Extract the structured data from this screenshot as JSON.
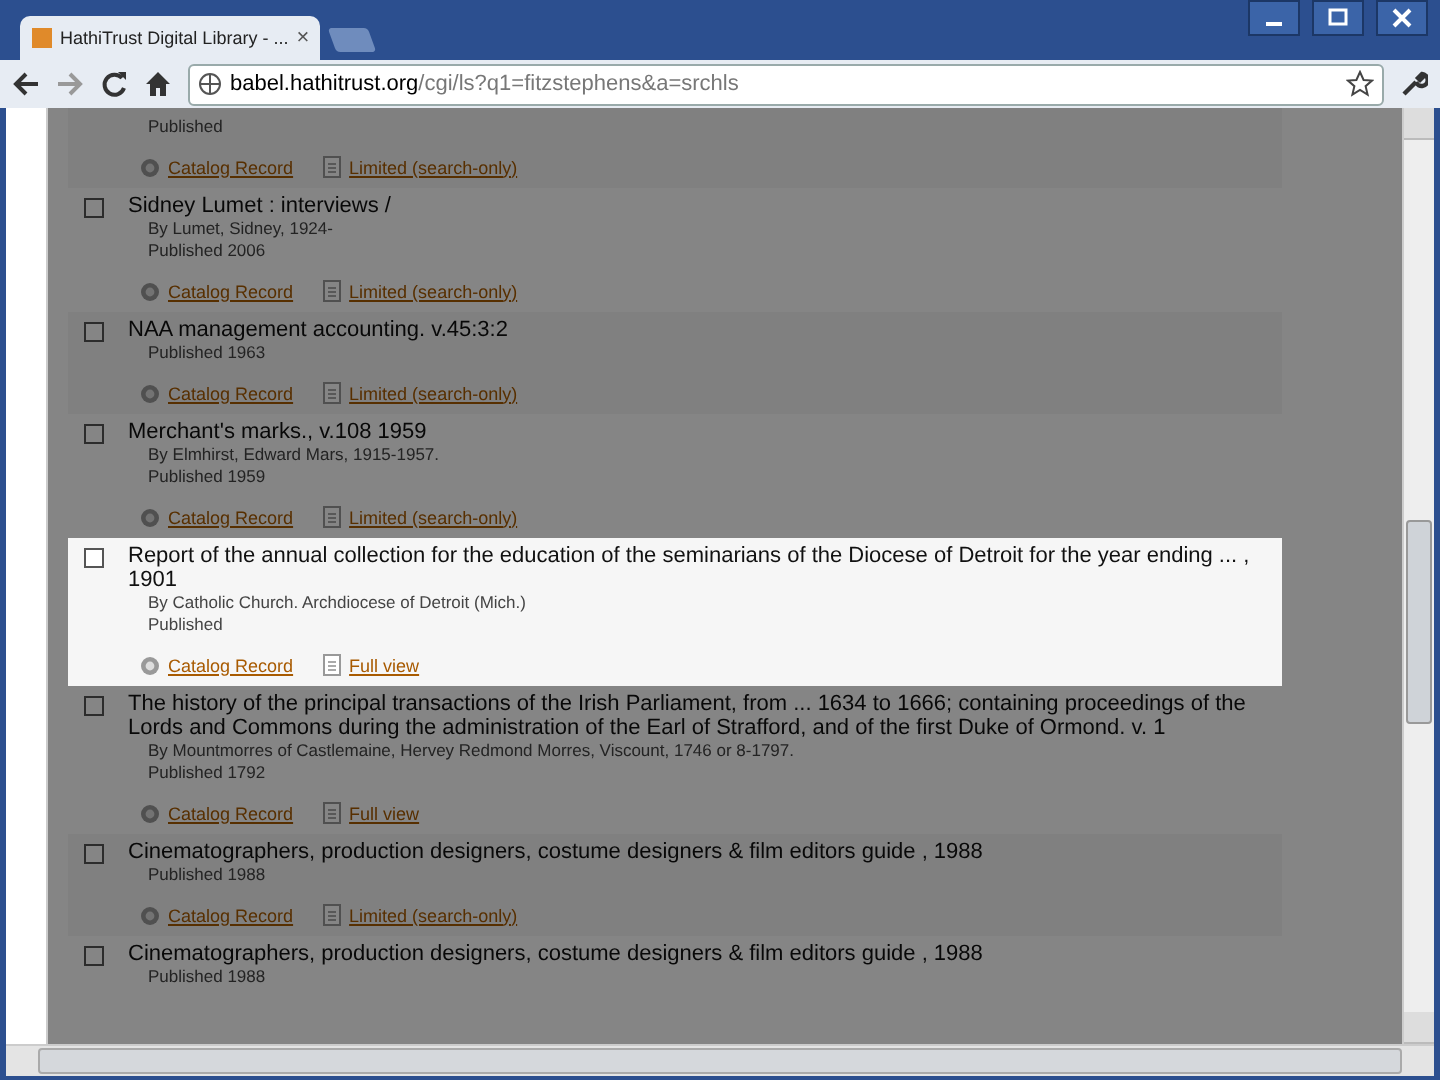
{
  "window": {
    "tab_title": "HathiTrust Digital Library - ...",
    "tab_close": "×"
  },
  "address_bar": {
    "domain": "babel.hathitrust.org",
    "path": "/cgi/ls?q1=fitzstephens&a=srchls"
  },
  "results": [
    {
      "published": "Published",
      "highlighted": false,
      "catalog_link": "Catalog Record",
      "access_link": "Limited (search-only)"
    },
    {
      "title": "Sidney Lumet : interviews /",
      "byline": "By Lumet, Sidney, 1924-",
      "published": "Published 2006",
      "highlighted": false,
      "catalog_link": "Catalog Record",
      "access_link": "Limited (search-only)"
    },
    {
      "title": "NAA management accounting. v.45:3:2",
      "published": "Published 1963",
      "highlighted": false,
      "catalog_link": "Catalog Record",
      "access_link": "Limited (search-only)"
    },
    {
      "title": "Merchant's marks., v.108 1959",
      "byline": "By Elmhirst, Edward Mars, 1915-1957.",
      "published": "Published 1959",
      "highlighted": false,
      "catalog_link": "Catalog Record",
      "access_link": "Limited (search-only)"
    },
    {
      "title": "Report of the annual collection for the education of the seminarians of the Diocese of Detroit for the year ending ... , 1901",
      "byline": "By Catholic Church. Archdiocese of Detroit (Mich.)",
      "published": "Published",
      "highlighted": true,
      "catalog_link": "Catalog Record",
      "access_link": "Full view"
    },
    {
      "title": "The history of the principal transactions of the Irish Parliament, from ... 1634 to 1666; containing proceedings of the Lords and Commons during the administration of the Earl of Strafford, and of the first Duke of Ormond. v. 1",
      "byline": "By Mountmorres of Castlemaine, Hervey Redmond Morres, Viscount, 1746 or 8-1797.",
      "published": "Published 1792",
      "highlighted": false,
      "catalog_link": "Catalog Record",
      "access_link": "Full view"
    },
    {
      "title": "Cinematographers, production designers, costume designers & film editors guide , 1988",
      "published": "Published 1988",
      "highlighted": false,
      "catalog_link": "Catalog Record",
      "access_link": "Limited (search-only)"
    },
    {
      "title": "Cinematographers, production designers, costume designers & film editors guide , 1988",
      "published": "Published 1988",
      "highlighted": false
    }
  ]
}
